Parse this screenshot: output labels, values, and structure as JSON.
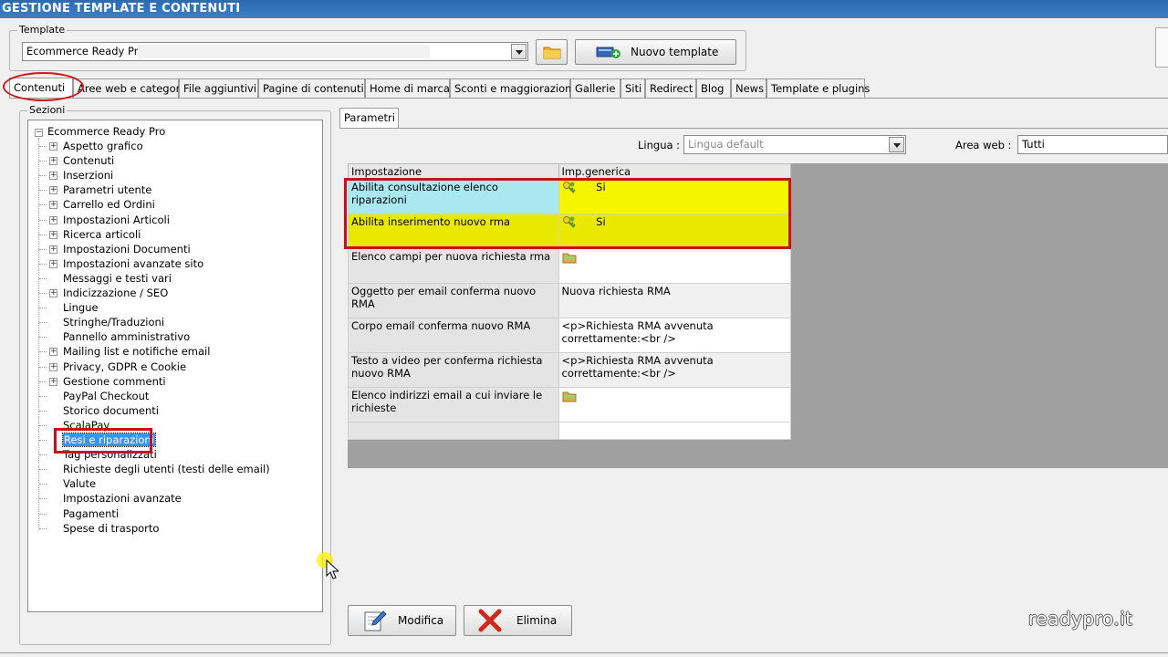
{
  "window": {
    "title": "GESTIONE TEMPLATE E CONTENUTI"
  },
  "template_group": {
    "label": "Template",
    "selected": "Ecommerce Ready Pro",
    "new_button": "Nuovo template"
  },
  "tabs": [
    "Contenuti",
    "Aree web e categorie",
    "File aggiuntivi",
    "Pagine di contenuti",
    "Home di marca",
    "Sconti e maggiorazioni",
    "Gallerie",
    "Siti",
    "Redirect",
    "Blog",
    "News",
    "Template e plugins"
  ],
  "sections": {
    "label": "Sezioni",
    "root": "Ecommerce Ready Pro",
    "items": [
      {
        "label": "Aspetto grafico",
        "expand": true
      },
      {
        "label": "Contenuti",
        "expand": true
      },
      {
        "label": "Inserzioni",
        "expand": true
      },
      {
        "label": "Parametri utente",
        "expand": true
      },
      {
        "label": "Carrello ed Ordini",
        "expand": true
      },
      {
        "label": "Impostazioni Articoli",
        "expand": true
      },
      {
        "label": "Ricerca articoli",
        "expand": true
      },
      {
        "label": "Impostazioni Documenti",
        "expand": true
      },
      {
        "label": "Impostazioni avanzate sito",
        "expand": true
      },
      {
        "label": "Messaggi e testi vari",
        "expand": false
      },
      {
        "label": "Indicizzazione / SEO",
        "expand": true
      },
      {
        "label": "Lingue",
        "expand": false
      },
      {
        "label": "Stringhe/Traduzioni",
        "expand": false
      },
      {
        "label": "Pannello amministrativo",
        "expand": false
      },
      {
        "label": "Mailing list e notifiche email",
        "expand": true
      },
      {
        "label": "Privacy, GDPR e Cookie",
        "expand": true
      },
      {
        "label": "Gestione commenti",
        "expand": true
      },
      {
        "label": "PayPal Checkout",
        "expand": false
      },
      {
        "label": "Storico documenti",
        "expand": false
      },
      {
        "label": "ScalaPay",
        "expand": false
      },
      {
        "label": "Resi e riparazioni",
        "expand": false,
        "selected": true
      },
      {
        "label": "Tag personalizzati",
        "expand": false
      },
      {
        "label": "Richieste degli utenti (testi delle email)",
        "expand": false
      },
      {
        "label": "Valute",
        "expand": false
      },
      {
        "label": "Impostazioni avanzate",
        "expand": false
      },
      {
        "label": "Pagamenti",
        "expand": false
      },
      {
        "label": "Spese di trasporto",
        "expand": false
      }
    ]
  },
  "params": {
    "tab": "Parametri",
    "lingua_label": "Lingua :",
    "lingua_value": "Lingua default",
    "area_label": "Area web :",
    "area_value": "Tutti",
    "col1": "Impostazione",
    "col2": "Imp.generica",
    "rows": [
      {
        "name": "Abilita consultazione elenco riparazioni",
        "value": "Si",
        "icon": "key-icon"
      },
      {
        "name": "Abilita inserimento nuovo rma",
        "value": "Si",
        "icon": "key-icon"
      },
      {
        "name": "Elenco campi per nuova richiesta rma",
        "value": "",
        "icon": "folder-icon"
      },
      {
        "name": "Oggetto per email conferma nuovo RMA",
        "value": "Nuova richiesta RMA",
        "icon": ""
      },
      {
        "name": "Corpo email conferma nuovo RMA",
        "value": "<p>Richiesta RMA avvenuta correttamente:<br />",
        "icon": ""
      },
      {
        "name": "Testo a video per conferma richiesta nuovo RMA",
        "value": "<p>Richiesta RMA avvenuta correttamente:<br />",
        "icon": ""
      },
      {
        "name": "Elenco indirizzi email a cui inviare le richieste",
        "value": "",
        "icon": "folder-icon"
      }
    ]
  },
  "buttons": {
    "modifica": "Modifica",
    "elimina": "Elimina"
  },
  "watermark": "readypro.it"
}
